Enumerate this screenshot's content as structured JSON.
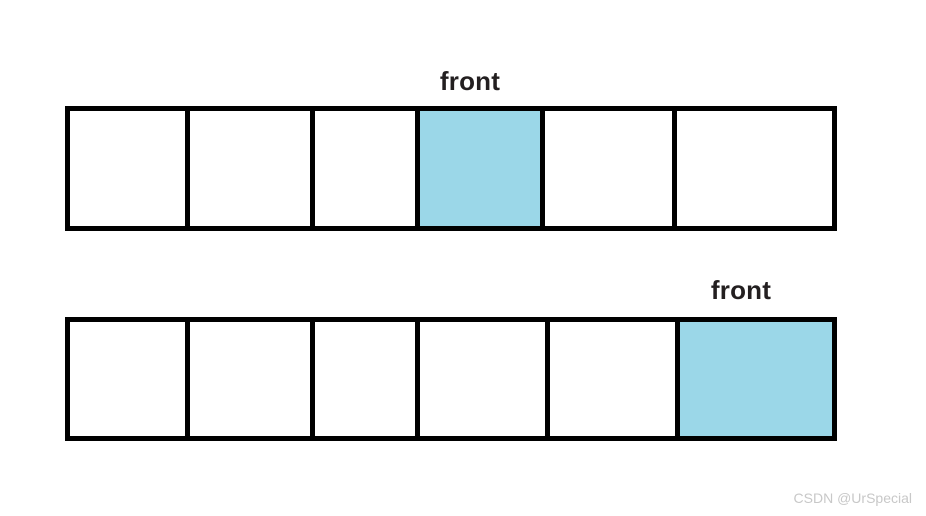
{
  "diagram": {
    "title": "queue front pointer illustration",
    "colors": {
      "background": "#ffffff",
      "border": "#000000",
      "highlight": "#9BD7E8",
      "label_text": "#231f20",
      "watermark_text": "#c8c8c8"
    },
    "rows": [
      {
        "id": "array-row-1",
        "cell_count": 6,
        "highlight_index": 3,
        "pointer": {
          "label": "front",
          "points_to_index": 3
        },
        "cells": [
          {
            "label": "",
            "highlighted": false
          },
          {
            "label": "",
            "highlighted": false
          },
          {
            "label": "",
            "highlighted": false
          },
          {
            "label": "",
            "highlighted": true
          },
          {
            "label": "",
            "highlighted": false
          },
          {
            "label": "",
            "highlighted": false
          }
        ]
      },
      {
        "id": "array-row-2",
        "cell_count": 6,
        "highlight_index": 5,
        "pointer": {
          "label": "front",
          "points_to_index": 5
        },
        "cells": [
          {
            "label": "",
            "highlighted": false
          },
          {
            "label": "",
            "highlighted": false
          },
          {
            "label": "",
            "highlighted": false
          },
          {
            "label": "",
            "highlighted": false
          },
          {
            "label": "",
            "highlighted": false
          },
          {
            "label": "",
            "highlighted": true
          }
        ]
      }
    ]
  },
  "watermark": {
    "text": "CSDN @UrSpecial"
  }
}
